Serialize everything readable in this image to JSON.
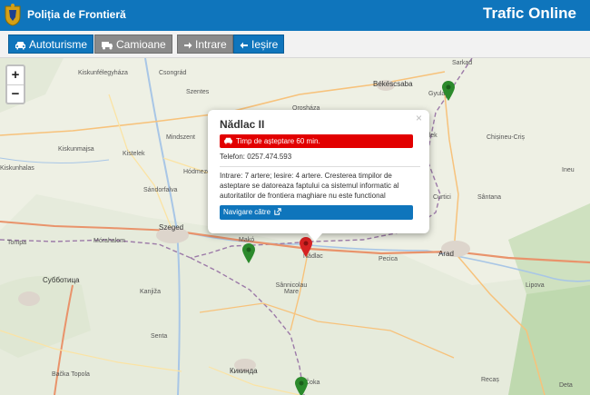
{
  "header": {
    "brand": "Poliția de Frontieră",
    "title": "Trafic Online"
  },
  "toolbar": {
    "cars_label": "Autoturisme",
    "trucks_label": "Camioane",
    "entry_label": "Intrare",
    "exit_label": "Ieșire"
  },
  "map": {
    "zoom_in": "+",
    "zoom_out": "−",
    "places": [
      "Kiskunfélegyháza",
      "Csongrád",
      "Szentes",
      "Orosháza",
      "Békéscsaba",
      "Gyula",
      "Sarkad",
      "Kiskunmajsa",
      "Kistelek",
      "Mindszent",
      "Hódmezővásárhely",
      "Sándorfalva",
      "Kiskunhalas",
      "Szeged",
      "Mórahalom",
      "Makó",
      "Nădlac",
      "Pecica",
      "Arad",
      "Sânnicolau Mare",
      "Субботица",
      "Kanjiža",
      "Senta",
      "Кикинда",
      "Bačka Topola",
      "Čoka",
      "Chișineu-Criș",
      "Curtici",
      "Sântana",
      "Lipova",
      "Recaș",
      "Ineu",
      "Elek",
      "Tompa",
      "Deta"
    ]
  },
  "popup": {
    "close": "×",
    "title": "Nădlac II",
    "wait": "Timp de așteptare 60 min.",
    "phone": "Telefon: 0257.474.593",
    "info": "Intrare: 7 artere; Iesire: 4 artere. Cresterea timpilor de asteptare se datoreaza faptului ca sistemul informatic al autoritatilor de frontiera maghiare nu este functional",
    "nav": "Navigare către"
  },
  "colors": {
    "brand_blue": "#0f75bc",
    "wait_red": "#e20000",
    "marker_green": "#2c8a2c",
    "marker_red": "#d62222"
  }
}
